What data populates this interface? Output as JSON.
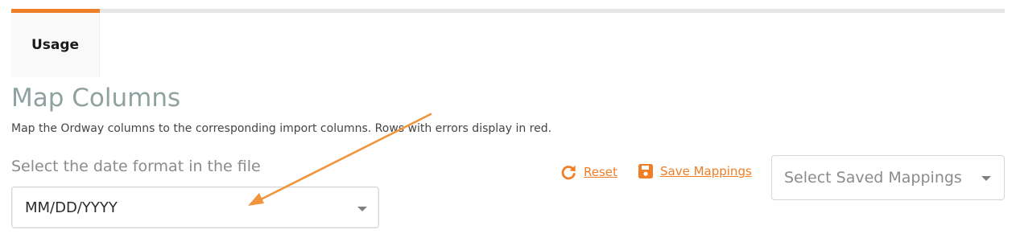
{
  "tabs": [
    {
      "label": "Usage",
      "active": true
    }
  ],
  "header": {
    "title": "Map Columns",
    "subtitle": "Map the Ordway columns to the corresponding import columns. Rows with errors display in red."
  },
  "date_format": {
    "label": "Select the date format in the file",
    "value": "MM/DD/YYYY"
  },
  "actions": {
    "reset_label": "Reset",
    "save_label": "Save Mappings"
  },
  "saved_mappings": {
    "placeholder": "Select Saved Mappings"
  },
  "icons": {
    "reset": "refresh-icon",
    "save": "floppy-disk-icon",
    "dropdown": "chevron-down-icon"
  },
  "colors": {
    "accent": "#ef7e27",
    "title": "#8fa2a0",
    "tab_strip": "#e6e6e6"
  }
}
